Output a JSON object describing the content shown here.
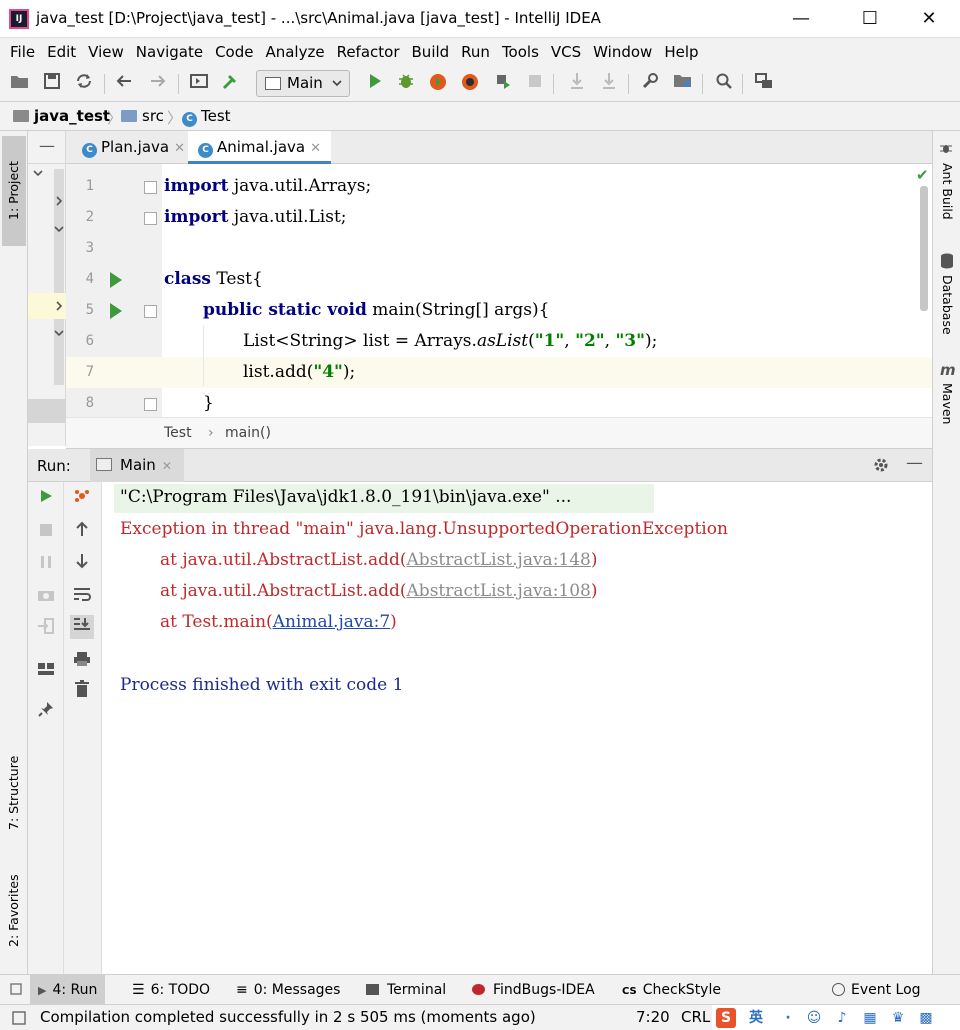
{
  "window": {
    "title": "java_test [D:\\Project\\java_test] - ...\\src\\Animal.java [java_test] - IntelliJ IDEA",
    "logo": "IJ",
    "minimize": "—",
    "maximize": "☐",
    "close": "✕"
  },
  "menu": [
    "File",
    "Edit",
    "View",
    "Navigate",
    "Code",
    "Analyze",
    "Refactor",
    "Build",
    "Run",
    "Tools",
    "VCS",
    "Window",
    "Help"
  ],
  "toolbar": {
    "run_config": "Main",
    "icons": [
      "open-folder-icon",
      "save-all-icon",
      "sync-icon",
      "back-arrow-icon",
      "forward-arrow-icon",
      "layout-icon",
      "build-hammer-icon",
      "run-icon",
      "debug-bug-icon",
      "coverage-icon",
      "profile-icon",
      "run-with-icon",
      "stop-icon",
      "vcs-update-icon",
      "vcs-commit-icon",
      "settings-wrench-icon",
      "project-structure-icon",
      "search-icon",
      "sdk-icon"
    ]
  },
  "navbar": {
    "project": "java_test",
    "folder": "src",
    "file": "Test"
  },
  "left_stripe": {
    "project": "1: Project",
    "structure": "7: Structure",
    "favorites": "2: Favorites"
  },
  "right_stripe": {
    "ant": "Ant Build",
    "database": "Database",
    "maven": "Maven"
  },
  "editor": {
    "tabs": [
      {
        "label": "Plan.java",
        "icon": "C"
      },
      {
        "label": "Animal.java",
        "icon": "C"
      }
    ],
    "line_numbers": [
      "1",
      "2",
      "3",
      "4",
      "5",
      "6",
      "7",
      "8"
    ],
    "lines": {
      "l1_kw": "import",
      "l1_rest": " java.util.Arrays;",
      "l2_kw": "import",
      "l2_rest": " java.util.List;",
      "l4_kw": "class",
      "l4_rest": " Test{",
      "l5_kw": "public static void",
      "l5_rest": " main(String[] args){",
      "l6_a": "List<String> list = Arrays.",
      "l6_method": "asList",
      "l6_b": "(",
      "l6_s1": "\"1\"",
      "l6_c1": ", ",
      "l6_s2": "\"2\"",
      "l6_c2": ", ",
      "l6_s3": "\"3\"",
      "l6_end": ");",
      "l7_a": "list.add(",
      "l7_s": "\"4\"",
      "l7_end": ");",
      "l8": "}"
    },
    "breadcrumb": {
      "class": "Test",
      "sep": "›",
      "method": "main()"
    }
  },
  "run": {
    "label": "Run:",
    "tab": "Main",
    "console": {
      "cmd": "\"C:\\Program Files\\Java\\jdk1.8.0_191\\bin\\java.exe\" ...",
      "exception": "Exception in thread \"main\" java.lang.UnsupportedOperationException",
      "at": "at ",
      "frame1": "java.util.AbstractList.add(",
      "frame1_link": "AbstractList.java:148",
      "frame2": "java.util.AbstractList.add(",
      "frame2_link": "AbstractList.java:108",
      "frame3": "Test.main(",
      "frame3_link": "Animal.java:7",
      "close": ")",
      "finished": "Process finished with exit code 1"
    }
  },
  "bottom_tabs": {
    "run": "4: Run",
    "todo": "6: TODO",
    "messages": "0: Messages",
    "terminal": "Terminal",
    "findbugs": "FindBugs-IDEA",
    "checkstyle": "CheckStyle",
    "eventlog": "Event Log"
  },
  "status": {
    "message": "Compilation completed successfully in 2 s 505 ms (moments ago)",
    "position": "7:20",
    "line_sep": "CRL",
    "ime_lang": "英"
  },
  "colors": {
    "keyword": "#000080",
    "string": "#008000",
    "error": "#c0292b",
    "run_green": "#3d9b3d"
  }
}
